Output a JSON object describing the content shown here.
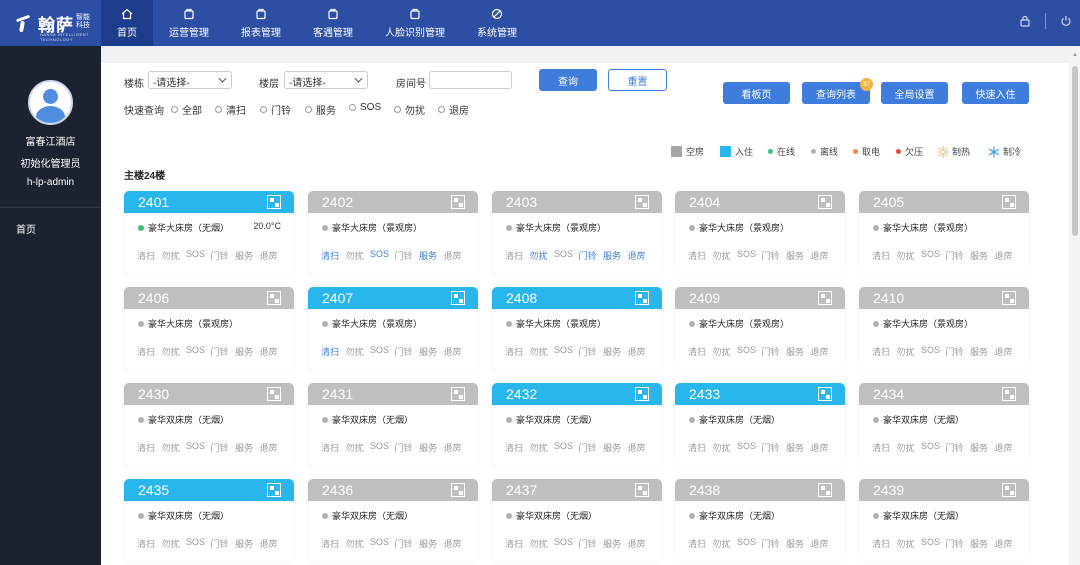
{
  "brand": {
    "name": "翰萨",
    "sub1": "智能",
    "sub2": "科技",
    "english": "HANSA INTELLIGENT TECHNOLOGY"
  },
  "nav": [
    {
      "label": "首页",
      "icon": "home-icon",
      "active": true
    },
    {
      "label": "运营管理",
      "icon": "operation-icon"
    },
    {
      "label": "报表管理",
      "icon": "report-icon"
    },
    {
      "label": "客遇管理",
      "icon": "guest-icon"
    },
    {
      "label": "人脸识别管理",
      "icon": "face-id-icon"
    },
    {
      "label": "系统管理",
      "icon": "settings-icon"
    }
  ],
  "topbar_icons": [
    "lock-icon",
    "power-icon"
  ],
  "sidebar": {
    "hotel": "富春江酒店",
    "role": "初始化管理员",
    "username": "h-lp-admin",
    "menu": [
      "首页"
    ]
  },
  "filter": {
    "building_label": "楼栋",
    "building_value": "-请选择-",
    "floor_label": "楼层",
    "floor_value": "-请选择-",
    "room_label": "房间号",
    "room_value": "",
    "search_btn": "查询",
    "reset_btn": "重置",
    "quick_label": "快速查询",
    "quick_options": [
      "全部",
      "清扫",
      "门铃",
      "服务",
      "SOS",
      "勿扰",
      "退房"
    ]
  },
  "actions": {
    "board": "看板页",
    "query_list": "查询列表",
    "query_badge": "37",
    "global": "全局设置",
    "checkin": "快速入住"
  },
  "legend": [
    {
      "label": "空房",
      "type": "square",
      "color": "#a6a6a6"
    },
    {
      "label": "入住",
      "type": "square",
      "color": "#29b6ec"
    },
    {
      "label": "在线",
      "type": "dot",
      "color": "#3ec07a"
    },
    {
      "label": "离线",
      "type": "dot",
      "color": "#b0b0b0"
    },
    {
      "label": "取电",
      "type": "dot",
      "color": "#f08a3c"
    },
    {
      "label": "欠压",
      "type": "dot",
      "color": "#e94b3c"
    },
    {
      "label": "制热",
      "type": "sun",
      "color": "#f3a53f"
    },
    {
      "label": "制冷",
      "type": "snow",
      "color": "#3e9ddb"
    }
  ],
  "floor_title": "主楼24楼",
  "op_labels": [
    "清扫",
    "勿扰",
    "SOS",
    "门铃",
    "服务",
    "退房"
  ],
  "rooms": [
    {
      "no": "2401",
      "status": "occupied",
      "type": "豪华大床房（无烟）",
      "online": true,
      "temp": "20.0°C",
      "active_ops": []
    },
    {
      "no": "2402",
      "status": "vacant",
      "type": "豪华大床房（景观房）",
      "online": false,
      "temp": "",
      "active_ops": [
        "清扫",
        "SOS",
        "服务"
      ]
    },
    {
      "no": "2403",
      "status": "vacant",
      "type": "豪华大床房（景观房）",
      "online": false,
      "temp": "",
      "active_ops": [
        "勿扰",
        "门铃",
        "服务",
        "退房"
      ]
    },
    {
      "no": "2404",
      "status": "vacant",
      "type": "豪华大床房（景观房）",
      "online": false,
      "temp": "",
      "active_ops": []
    },
    {
      "no": "2405",
      "status": "vacant",
      "type": "豪华大床房（景观房）",
      "online": false,
      "temp": "",
      "active_ops": []
    },
    {
      "no": "2406",
      "status": "vacant",
      "type": "豪华大床房（景观房）",
      "online": false,
      "temp": "",
      "active_ops": []
    },
    {
      "no": "2407",
      "status": "occupied",
      "type": "豪华大床房（景观房）",
      "online": false,
      "temp": "",
      "active_ops": [
        "清扫"
      ]
    },
    {
      "no": "2408",
      "status": "occupied",
      "type": "豪华大床房（景观房）",
      "online": false,
      "temp": "",
      "active_ops": []
    },
    {
      "no": "2409",
      "status": "vacant",
      "type": "豪华大床房（景观房）",
      "online": false,
      "temp": "",
      "active_ops": []
    },
    {
      "no": "2410",
      "status": "vacant",
      "type": "豪华大床房（景观房）",
      "online": false,
      "temp": "",
      "active_ops": []
    },
    {
      "no": "2430",
      "status": "vacant",
      "type": "豪华双床房（无烟）",
      "online": false,
      "temp": "",
      "active_ops": []
    },
    {
      "no": "2431",
      "status": "vacant",
      "type": "豪华双床房（无烟）",
      "online": false,
      "temp": "",
      "active_ops": []
    },
    {
      "no": "2432",
      "status": "occupied",
      "type": "豪华双床房（无烟）",
      "online": false,
      "temp": "",
      "active_ops": []
    },
    {
      "no": "2433",
      "status": "occupied",
      "type": "豪华双床房（无烟）",
      "online": false,
      "temp": "",
      "active_ops": []
    },
    {
      "no": "2434",
      "status": "vacant",
      "type": "豪华双床房（无烟）",
      "online": false,
      "temp": "",
      "active_ops": []
    },
    {
      "no": "2435",
      "status": "occupied",
      "type": "豪华双床房（无烟）",
      "online": false,
      "temp": "",
      "active_ops": []
    },
    {
      "no": "2436",
      "status": "vacant",
      "type": "豪华双床房（无烟）",
      "online": false,
      "temp": "",
      "active_ops": []
    },
    {
      "no": "2437",
      "status": "vacant",
      "type": "豪华双床房（无烟）",
      "online": false,
      "temp": "",
      "active_ops": []
    },
    {
      "no": "2438",
      "status": "vacant",
      "type": "豪华双床房（无烟）",
      "online": false,
      "temp": "",
      "active_ops": []
    },
    {
      "no": "2439",
      "status": "vacant",
      "type": "豪华双床房（无烟）",
      "online": false,
      "temp": "",
      "active_ops": []
    }
  ]
}
